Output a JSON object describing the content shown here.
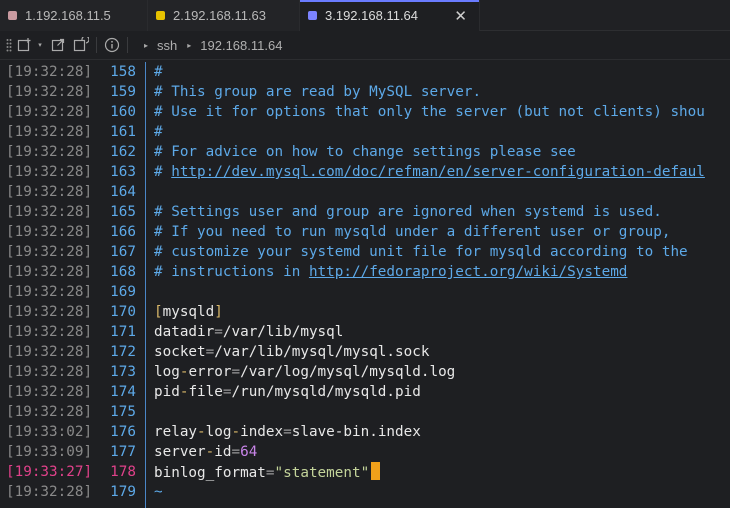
{
  "tabs": [
    {
      "label": "1.192.168.11.5",
      "color": "#c99aa0"
    },
    {
      "label": "2.192.168.11.63",
      "color": "#e6c200"
    },
    {
      "label": "3.192.168.11.64",
      "color": "#7c83ff"
    }
  ],
  "toolbar": {
    "protocol": "ssh",
    "host": "192.168.11.64"
  },
  "lines": {
    "l158": {
      "ts": "[19:32:28]",
      "n": "158",
      "c": "#"
    },
    "l159": {
      "ts": "[19:32:28]",
      "n": "159",
      "c": "# This group are read by MySQL server."
    },
    "l160": {
      "ts": "[19:32:28]",
      "n": "160",
      "c": "# Use it for options that only the server (but not clients) shou"
    },
    "l161": {
      "ts": "[19:32:28]",
      "n": "161",
      "c": "#"
    },
    "l162": {
      "ts": "[19:32:28]",
      "n": "162",
      "c": "# For advice on how to change settings please see"
    },
    "l163": {
      "ts": "[19:32:28]",
      "n": "163",
      "c": "# ",
      "url": "http://dev.mysql.com/doc/refman/en/server-configuration-defaul"
    },
    "l164": {
      "ts": "[19:32:28]",
      "n": "164"
    },
    "l165": {
      "ts": "[19:32:28]",
      "n": "165",
      "c": "# Settings user and group are ignored when systemd is used."
    },
    "l166": {
      "ts": "[19:32:28]",
      "n": "166",
      "c": "# If you need to run mysqld under a different user or group,"
    },
    "l167": {
      "ts": "[19:32:28]",
      "n": "167",
      "c": "# customize your systemd unit file for mysqld according to the"
    },
    "l168": {
      "ts": "[19:32:28]",
      "n": "168",
      "c": "# instructions in ",
      "url": "http://fedoraproject.org/wiki/Systemd"
    },
    "l169": {
      "ts": "[19:32:28]",
      "n": "169"
    },
    "l170": {
      "ts": "[19:32:28]",
      "n": "170",
      "open": "[",
      "section": "mysqld",
      "close": "]"
    },
    "l171": {
      "ts": "[19:32:28]",
      "n": "171",
      "k1": "datadir",
      "eq": "=",
      "v": "/var/lib/mysql"
    },
    "l172": {
      "ts": "[19:32:28]",
      "n": "172",
      "k1": "socket",
      "eq": "=",
      "v": "/var/lib/mysql/mysql.sock"
    },
    "l173": {
      "ts": "[19:32:28]",
      "n": "173",
      "k1": "log",
      "d1": "-",
      "k2": "error",
      "eq": "=",
      "v": "/var/log/mysql/mysqld.log"
    },
    "l174": {
      "ts": "[19:32:28]",
      "n": "174",
      "k1": "pid",
      "d1": "-",
      "k2": "file",
      "eq": "=",
      "v": "/run/mysqld/mysqld.pid"
    },
    "l175": {
      "ts": "[19:32:28]",
      "n": "175"
    },
    "l176": {
      "ts": "[19:33:02]",
      "n": "176",
      "k1": "relay",
      "d1": "-",
      "k2": "log",
      "d2": "-",
      "k3": "index",
      "eq": "=",
      "v": "slave-bin.index"
    },
    "l177": {
      "ts": "[19:33:09]",
      "n": "177",
      "k1": "server",
      "d1": "-",
      "k2": "id",
      "eq": "=",
      "v": "64"
    },
    "l178": {
      "ts": "[19:33:27]",
      "n": "178",
      "k1": "binlog_format",
      "eq": "=",
      "v": "\"statement\""
    },
    "l179": {
      "ts": "[19:32:28]",
      "n": "179",
      "c": "~"
    }
  },
  "colors": {
    "highlight": "#e0418a",
    "cursor": "#f0a01a",
    "comment": "#5da9e8"
  }
}
